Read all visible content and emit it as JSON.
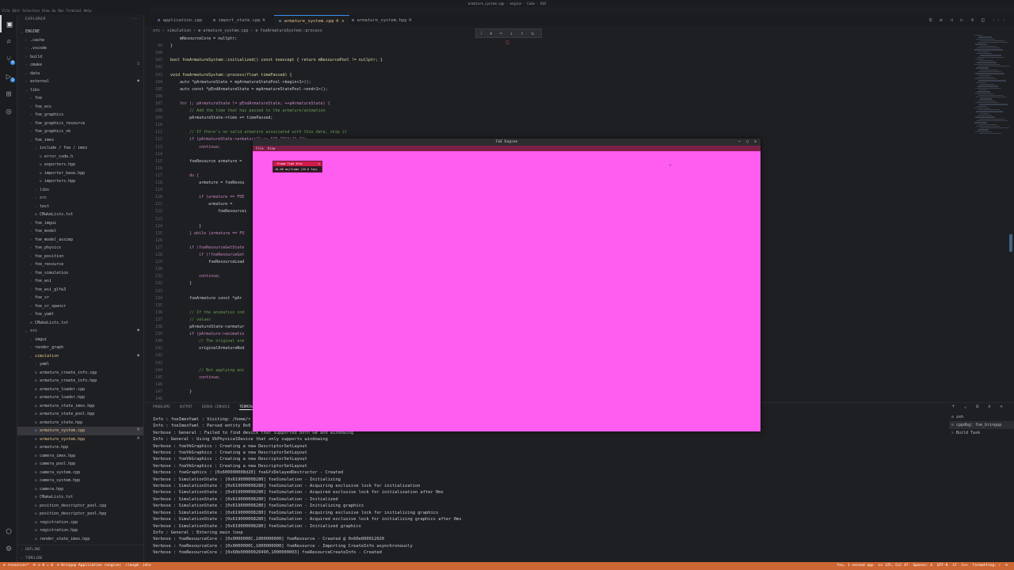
{
  "window": {
    "title": "armature_system.cpp - engine - Code - OSS"
  },
  "menu": [
    "File",
    "Edit",
    "Selection",
    "View",
    "Go",
    "Run",
    "Terminal",
    "Help"
  ],
  "activity": [
    {
      "icon": "files-icon",
      "glyph": "▣"
    },
    {
      "icon": "search-icon",
      "glyph": "⌕"
    },
    {
      "icon": "source-control-icon",
      "glyph": "⑂",
      "badge": "4"
    },
    {
      "icon": "run-debug-icon",
      "glyph": "▷",
      "badge": "1"
    },
    {
      "icon": "extensions-icon",
      "glyph": "⊞"
    },
    {
      "icon": "remote-icon",
      "glyph": "◎"
    }
  ],
  "activity_bottom": [
    {
      "icon": "account-icon",
      "glyph": "◯"
    },
    {
      "icon": "settings-gear-icon",
      "glyph": "⚙"
    }
  ],
  "explorer": {
    "header": "EXPLORER",
    "more": "···",
    "items": [
      {
        "label": "ENGINE",
        "depth": 0,
        "arrow": "⌄",
        "kind": "folder"
      },
      {
        "label": ".cache",
        "depth": 1,
        "arrow": "›",
        "kind": "folder"
      },
      {
        "label": ".vscode",
        "depth": 1,
        "arrow": "›",
        "kind": "folder"
      },
      {
        "label": "build",
        "depth": 1,
        "arrow": "›",
        "kind": "folder"
      },
      {
        "label": "cmake",
        "depth": 1,
        "arrow": "›",
        "kind": "folder",
        "mark": "5"
      },
      {
        "label": "data",
        "depth": 1,
        "arrow": "›",
        "kind": "folder"
      },
      {
        "label": "external",
        "depth": 1,
        "arrow": "›",
        "kind": "folder",
        "mark": "●"
      },
      {
        "label": "libs",
        "depth": 1,
        "arrow": "⌄",
        "kind": "folder"
      },
      {
        "label": "foe",
        "depth": 2,
        "arrow": "›",
        "kind": "folder"
      },
      {
        "label": "foe_ecs",
        "depth": 2,
        "arrow": "›",
        "kind": "folder"
      },
      {
        "label": "foe_graphics",
        "depth": 2,
        "arrow": "›",
        "kind": "folder"
      },
      {
        "label": "foe_graphics_resource",
        "depth": 2,
        "arrow": "›",
        "kind": "folder"
      },
      {
        "label": "foe_graphics_vk",
        "depth": 2,
        "arrow": "›",
        "kind": "folder"
      },
      {
        "label": "foe_imex",
        "depth": 2,
        "arrow": "⌄",
        "kind": "folder"
      },
      {
        "label": "include / foe / imex",
        "depth": 3,
        "arrow": "⌄",
        "kind": "folder"
      },
      {
        "label": "error_code.h",
        "depth": 4,
        "arrow": "",
        "kind": "file"
      },
      {
        "label": "exporters.hpp",
        "depth": 4,
        "arrow": "",
        "kind": "file"
      },
      {
        "label": "importer_base.hpp",
        "depth": 4,
        "arrow": "",
        "kind": "file"
      },
      {
        "label": "importers.hpp",
        "depth": 4,
        "arrow": "",
        "kind": "file"
      },
      {
        "label": "libs",
        "depth": 3,
        "arrow": "›",
        "kind": "folder"
      },
      {
        "label": "src",
        "depth": 3,
        "arrow": "›",
        "kind": "folder"
      },
      {
        "label": "test",
        "depth": 3,
        "arrow": "›",
        "kind": "folder"
      },
      {
        "label": "CMakeLists.txt",
        "depth": 3,
        "arrow": "",
        "kind": "file"
      },
      {
        "label": "foe_imgui",
        "depth": 2,
        "arrow": "›",
        "kind": "folder"
      },
      {
        "label": "foe_model",
        "depth": 2,
        "arrow": "›",
        "kind": "folder"
      },
      {
        "label": "foe_model_assimp",
        "depth": 2,
        "arrow": "›",
        "kind": "folder"
      },
      {
        "label": "foe_physics",
        "depth": 2,
        "arrow": "›",
        "kind": "folder"
      },
      {
        "label": "foe_position",
        "depth": 2,
        "arrow": "›",
        "kind": "folder"
      },
      {
        "label": "foe_resource",
        "depth": 2,
        "arrow": "›",
        "kind": "folder"
      },
      {
        "label": "foe_simulation",
        "depth": 2,
        "arrow": "›",
        "kind": "folder"
      },
      {
        "label": "foe_wsi",
        "depth": 2,
        "arrow": "›",
        "kind": "folder"
      },
      {
        "label": "foe_wsi_glfw3",
        "depth": 2,
        "arrow": "›",
        "kind": "folder"
      },
      {
        "label": "foe_xr",
        "depth": 2,
        "arrow": "›",
        "kind": "folder"
      },
      {
        "label": "foe_xr_openxr",
        "depth": 2,
        "arrow": "›",
        "kind": "folder"
      },
      {
        "label": "foe_yaml",
        "depth": 2,
        "arrow": "›",
        "kind": "folder"
      },
      {
        "label": "CMakeLists.txt",
        "depth": 2,
        "arrow": "",
        "kind": "file"
      },
      {
        "label": "src",
        "depth": 1,
        "arrow": "⌄",
        "kind": "folder",
        "mark": "●"
      },
      {
        "label": "imgui",
        "depth": 2,
        "arrow": "›",
        "kind": "folder"
      },
      {
        "label": "render_graph",
        "depth": 2,
        "arrow": "›",
        "kind": "folder"
      },
      {
        "label": "simulation",
        "depth": 2,
        "arrow": "⌄",
        "kind": "folder",
        "mark": "●",
        "modified": true
      },
      {
        "label": "yaml",
        "depth": 3,
        "arrow": "›",
        "kind": "folder"
      },
      {
        "label": "armature_create_info.cpp",
        "depth": 3,
        "arrow": "",
        "kind": "file"
      },
      {
        "label": "armature_create_info.hpp",
        "depth": 3,
        "arrow": "",
        "kind": "file"
      },
      {
        "label": "armature_loader.cpp",
        "depth": 3,
        "arrow": "",
        "kind": "file"
      },
      {
        "label": "armature_loader.hpp",
        "depth": 3,
        "arrow": "",
        "kind": "file"
      },
      {
        "label": "armature_state_imex.hpp",
        "depth": 3,
        "arrow": "",
        "kind": "file"
      },
      {
        "label": "armature_state_pool.hpp",
        "depth": 3,
        "arrow": "",
        "kind": "file"
      },
      {
        "label": "armature_state.hpp",
        "depth": 3,
        "arrow": "",
        "kind": "file"
      },
      {
        "label": "armature_system.cpp",
        "depth": 3,
        "arrow": "",
        "kind": "file",
        "mark": "M",
        "selected": true,
        "modified": true
      },
      {
        "label": "armature_system.hpp",
        "depth": 3,
        "arrow": "",
        "kind": "file",
        "mark": "M",
        "modified": true
      },
      {
        "label": "armature.hpp",
        "depth": 3,
        "arrow": "",
        "kind": "file"
      },
      {
        "label": "camera_imex.hpp",
        "depth": 3,
        "arrow": "",
        "kind": "file"
      },
      {
        "label": "camera_pool.hpp",
        "depth": 3,
        "arrow": "",
        "kind": "file"
      },
      {
        "label": "camera_system.cpp",
        "depth": 3,
        "arrow": "",
        "kind": "file"
      },
      {
        "label": "camera_system.hpp",
        "depth": 3,
        "arrow": "",
        "kind": "file"
      },
      {
        "label": "camera.hpp",
        "depth": 3,
        "arrow": "",
        "kind": "file"
      },
      {
        "label": "CMakeLists.txt",
        "depth": 3,
        "arrow": "",
        "kind": "file"
      },
      {
        "label": "position_descriptor_pool.cpp",
        "depth": 3,
        "arrow": "",
        "kind": "file"
      },
      {
        "label": "position_descriptor_pool.hpp",
        "depth": 3,
        "arrow": "",
        "kind": "file"
      },
      {
        "label": "registration.cpp",
        "depth": 3,
        "arrow": "",
        "kind": "file"
      },
      {
        "label": "registration.hpp",
        "depth": 3,
        "arrow": "",
        "kind": "file"
      },
      {
        "label": "render_state_imex.hpp",
        "depth": 3,
        "arrow": "",
        "kind": "file"
      }
    ],
    "outline": "OUTLINE",
    "timeline": "TIMELINE"
  },
  "tabs": [
    {
      "label": "application.cpp",
      "mark": "",
      "active": false
    },
    {
      "label": "import_state.cpp",
      "mark": "M",
      "active": false
    },
    {
      "label": "armature_system.cpp",
      "mark": "M",
      "active": true
    },
    {
      "label": "armature_system.hpp",
      "mark": "M",
      "active": false
    }
  ],
  "editor_tools": "⊡ ⇄ ◁ ▷ ⊘ ◫ ···",
  "breadcrumb": "src › simulation › ⊞ armature_system.cpp › ⊕ foeArmatureSystem::process",
  "debug_toolbar": {
    "left": "⁞ ⏸ ↷ ↓ ↑ ↻",
    "stop": "□"
  },
  "code": [
    {
      "n": "",
      "t": "    mResourceCore = nullptr;",
      "c": ""
    },
    {
      "n": "99",
      "t": "}",
      "c": ""
    },
    {
      "n": "100",
      "t": "",
      "c": ""
    },
    {
      "n": "101",
      "t": "bool foeArmatureSystem::initialized() const noexcept { return mResourcePool != nullptr; }",
      "c": "fn"
    },
    {
      "n": "102",
      "t": "",
      "c": ""
    },
    {
      "n": "103",
      "t": "void foeArmatureSystem::process(float timePassed) {",
      "c": "fn"
    },
    {
      "n": "104",
      "t": "    auto *pArmatureState = mpArmatureStatePool->begin<1>();",
      "c": ""
    },
    {
      "n": "105",
      "t": "    auto const *pEndArmatureState = mpArmatureStatePool->end<1>();",
      "c": ""
    },
    {
      "n": "106",
      "t": "",
      "c": ""
    },
    {
      "n": "107",
      "t": "    for (; pArmatureState != pEndArmatureState; ++pArmatureState) {",
      "c": "keyword"
    },
    {
      "n": "108",
      "t": "        // Add the time that has passed to the armature/animation",
      "c": "comment"
    },
    {
      "n": "109",
      "t": "        pArmatureState->time += timePassed;",
      "c": ""
    },
    {
      "n": "110",
      "t": "",
      "c": ""
    },
    {
      "n": "111",
      "t": "        // If there's no valid armature associated with this data, skip it",
      "c": "comment"
    },
    {
      "n": "112",
      "t": "        if (pArmatureState->armatureID == FOE_INVALID_ID)",
      "c": "keyword"
    },
    {
      "n": "113",
      "t": "            continue;",
      "c": "keyword"
    },
    {
      "n": "114",
      "t": "",
      "c": ""
    },
    {
      "n": "115",
      "t": "        foeResource armature =",
      "c": ""
    },
    {
      "n": "116",
      "t": "",
      "c": ""
    },
    {
      "n": "117",
      "t": "        do {",
      "c": "keyword"
    },
    {
      "n": "118",
      "t": "            armature = foeResou",
      "c": ""
    },
    {
      "n": "119",
      "t": "",
      "c": ""
    },
    {
      "n": "120",
      "t": "            if (armature == FOE",
      "c": "keyword"
    },
    {
      "n": "121",
      "t": "                armature =",
      "c": ""
    },
    {
      "n": "122",
      "t": "                    foeResourcei",
      "c": ""
    },
    {
      "n": "123",
      "t": "",
      "c": ""
    },
    {
      "n": "124",
      "t": "            }",
      "c": ""
    },
    {
      "n": "125",
      "t": "        } while (armature == FO",
      "c": "keyword"
    },
    {
      "n": "126",
      "t": "",
      "c": ""
    },
    {
      "n": "127",
      "t": "        if (foeResourceGetState",
      "c": "keyword"
    },
    {
      "n": "128",
      "t": "            if (!foeResourceGet",
      "c": "keyword"
    },
    {
      "n": "129",
      "t": "                foeResourceLoad",
      "c": ""
    },
    {
      "n": "130",
      "t": "",
      "c": ""
    },
    {
      "n": "131",
      "t": "            continue;",
      "c": "keyword"
    },
    {
      "n": "132",
      "t": "        }",
      "c": ""
    },
    {
      "n": "133",
      "t": "",
      "c": ""
    },
    {
      "n": "134",
      "t": "        foeArmature const *pAr",
      "c": ""
    },
    {
      "n": "135",
      "t": "",
      "c": ""
    },
    {
      "n": "136",
      "t": "        // If the animation ind",
      "c": "comment"
    },
    {
      "n": "137",
      "t": "        // values",
      "c": "comment"
    },
    {
      "n": "138",
      "t": "        pArmatureState->armatur",
      "c": ""
    },
    {
      "n": "139",
      "t": "        if (pArmature->animatio",
      "c": "keyword"
    },
    {
      "n": "140",
      "t": "            // The original arm",
      "c": "comment"
    },
    {
      "n": "141",
      "t": "            originalArmatureNod",
      "c": ""
    },
    {
      "n": "142",
      "t": "",
      "c": ""
    },
    {
      "n": "143",
      "t": "",
      "c": ""
    },
    {
      "n": "144",
      "t": "            // Not applying ani",
      "c": "comment"
    },
    {
      "n": "145",
      "t": "            continue;",
      "c": "keyword"
    },
    {
      "n": "146",
      "t": "",
      "c": ""
    },
    {
      "n": "147",
      "t": "        }",
      "c": ""
    },
    {
      "n": "148",
      "t": "",
      "c": ""
    },
    {
      "n": "149",
      "t": "        foeAnimation const &ani",
      "c": ""
    }
  ],
  "panel": {
    "tabs": [
      "PROBLEMS",
      "OUTPUT",
      "DEBUG CONSOLE",
      "TERMINAL"
    ],
    "active_tab": "TERMINAL",
    "tools": "+ ⌄ ⊟ ∧ ✕",
    "terminal": [
      "Info : foeImexYaml : Visiting: /home/r",
      "Info : foeImexYaml : Parsed entity 0x0",
      "Verbose : General : Failed to find device that supported both GW and windowing",
      "Info : General : Using VkPhysicalDevice that only supports windowing",
      "Verbose : foeVkGraphics : Creating a new DescriptorSetLayout",
      "Verbose : foeVkGraphics : Creating a new DescriptorSetLayout",
      "Verbose : foeVkGraphics : Creating a new DescriptorSetLayout",
      "Verbose : foeVkGraphics : Creating a new DescriptorSetLayout",
      "Verbose : foeGraphics : [0x600000008d20] foeGfxDelayedDestructor - Created",
      "Verbose : SimulationState : [0x619000008280] foeSimulation - Initializing",
      "Verbose : SimulationState : [0x619000008280] foeSimulation - Acquiring exclusive lock for initialization",
      "Verbose : SimulationState : [0x619000008280] foeSimulation - Acquired exclusive lock for initialization after 0ms",
      "Verbose : SimulationState : [0x619000008280] foeSimulation - Initialized",
      "Verbose : SimulationState : [0x619000008280] foeSimulation - Initializing graphics",
      "Verbose : SimulationState : [0x619000008280] foeSimulation - Acquiring exclusive lock for initializing graphics",
      "Verbose : SimulationState : [0x619000008280] foeSimulation - Acquired exclusive lock for initializing graphics after 0ms",
      "Verbose : SimulationState : [0x619000008280] foeSimulation - Initialized graphics",
      "Info : General : Entering main loop",
      "Verbose : foeResourceCore : [0x0000000C,1000000000] foeResource - Created @ 0x60e000012020",
      "Verbose : foeResourceCore : [0x0000000C,1000000000] foeResource - Importing CreateInfo asynchronously",
      "Verbose : foeResourceCore : [0x60b00000020490,1000000003] foeResourceCreateInfo - Created"
    ],
    "sessions": [
      {
        "icon": "terminal-icon",
        "glyph": "⊡",
        "label": "zsh",
        "active": false
      },
      {
        "icon": "debug-icon",
        "glyph": "⚙",
        "label": "cppdbg: foe_bringup",
        "active": true
      },
      {
        "icon": "tool-icon",
        "glyph": "✎",
        "label": "Build  Task",
        "active": false
      }
    ]
  },
  "statusbar": {
    "left": [
      "⊡ resources*",
      "⟳ ⊘ 0 ⚠ 0",
      "⊡ Bringup Application (engine)",
      "clangd: idle"
    ],
    "right": [
      "You, 1 second ago",
      "Ln 125, Col 47",
      "Spaces: 4",
      "UTF-8",
      "LF",
      "C++",
      "Formatting: ✓",
      "⊡"
    ]
  },
  "app_window": {
    "title": "FoE Engine",
    "controls": "– ▢ ✕",
    "menu": [
      "File",
      "View"
    ],
    "frame_timer": {
      "title": "Frame Time Info",
      "text": "16.66 ms/frame (55.6 fps)"
    },
    "bg_color": "#ff5cf0"
  },
  "colors": {
    "accent": "#3b8eea",
    "status": "#cc6633",
    "modified": "#e2c08d",
    "magenta": "#ff5cf0"
  }
}
